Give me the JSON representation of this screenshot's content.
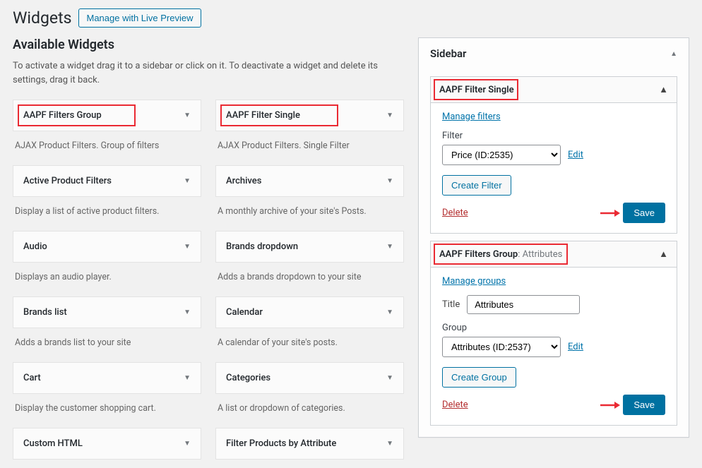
{
  "header": {
    "title": "Widgets",
    "preview_button": "Manage with Live Preview"
  },
  "sections": {
    "available_title": "Available Widgets",
    "available_subtitle": "To activate a widget drag it to a sidebar or click on it. To deactivate a widget and delete its settings, drag it back."
  },
  "widgets": [
    {
      "name": "AAPF Filters Group",
      "desc": "AJAX Product Filters. Group of filters",
      "highlight": true
    },
    {
      "name": "AAPF Filter Single",
      "desc": "AJAX Product Filters. Single Filter",
      "highlight": true
    },
    {
      "name": "Active Product Filters",
      "desc": "Display a list of active product filters."
    },
    {
      "name": "Archives",
      "desc": "A monthly archive of your site's Posts."
    },
    {
      "name": "Audio",
      "desc": "Displays an audio player."
    },
    {
      "name": "Brands dropdown",
      "desc": "Adds a brands dropdown to your site"
    },
    {
      "name": "Brands list",
      "desc": "Adds a brands list to your site"
    },
    {
      "name": "Calendar",
      "desc": "A calendar of your site's posts."
    },
    {
      "name": "Cart",
      "desc": "Display the customer shopping cart."
    },
    {
      "name": "Categories",
      "desc": "A list or dropdown of categories."
    },
    {
      "name": "Custom HTML",
      "desc": ""
    },
    {
      "name": "Filter Products by Attribute",
      "desc": ""
    }
  ],
  "sidebar": {
    "title": "Sidebar",
    "panels": [
      {
        "title": "AAPF Filter Single",
        "sublabel": "",
        "manage_link": "Manage filters",
        "fields": [
          {
            "type": "select-inline",
            "label": "Filter",
            "value": "Price (ID:2535)",
            "edit": "Edit"
          }
        ],
        "create_btn": "Create Filter",
        "delete": "Delete",
        "save": "Save"
      },
      {
        "title": "AAPF Filters Group",
        "sublabel": ": Attributes",
        "manage_link": "Manage groups",
        "fields": [
          {
            "type": "text-inline",
            "label": "Title",
            "value": "Attributes"
          },
          {
            "type": "select-block",
            "label": "Group",
            "value": "Attributes (ID:2537)",
            "edit": "Edit"
          }
        ],
        "create_btn": "Create Group",
        "delete": "Delete",
        "save": "Save"
      }
    ]
  }
}
